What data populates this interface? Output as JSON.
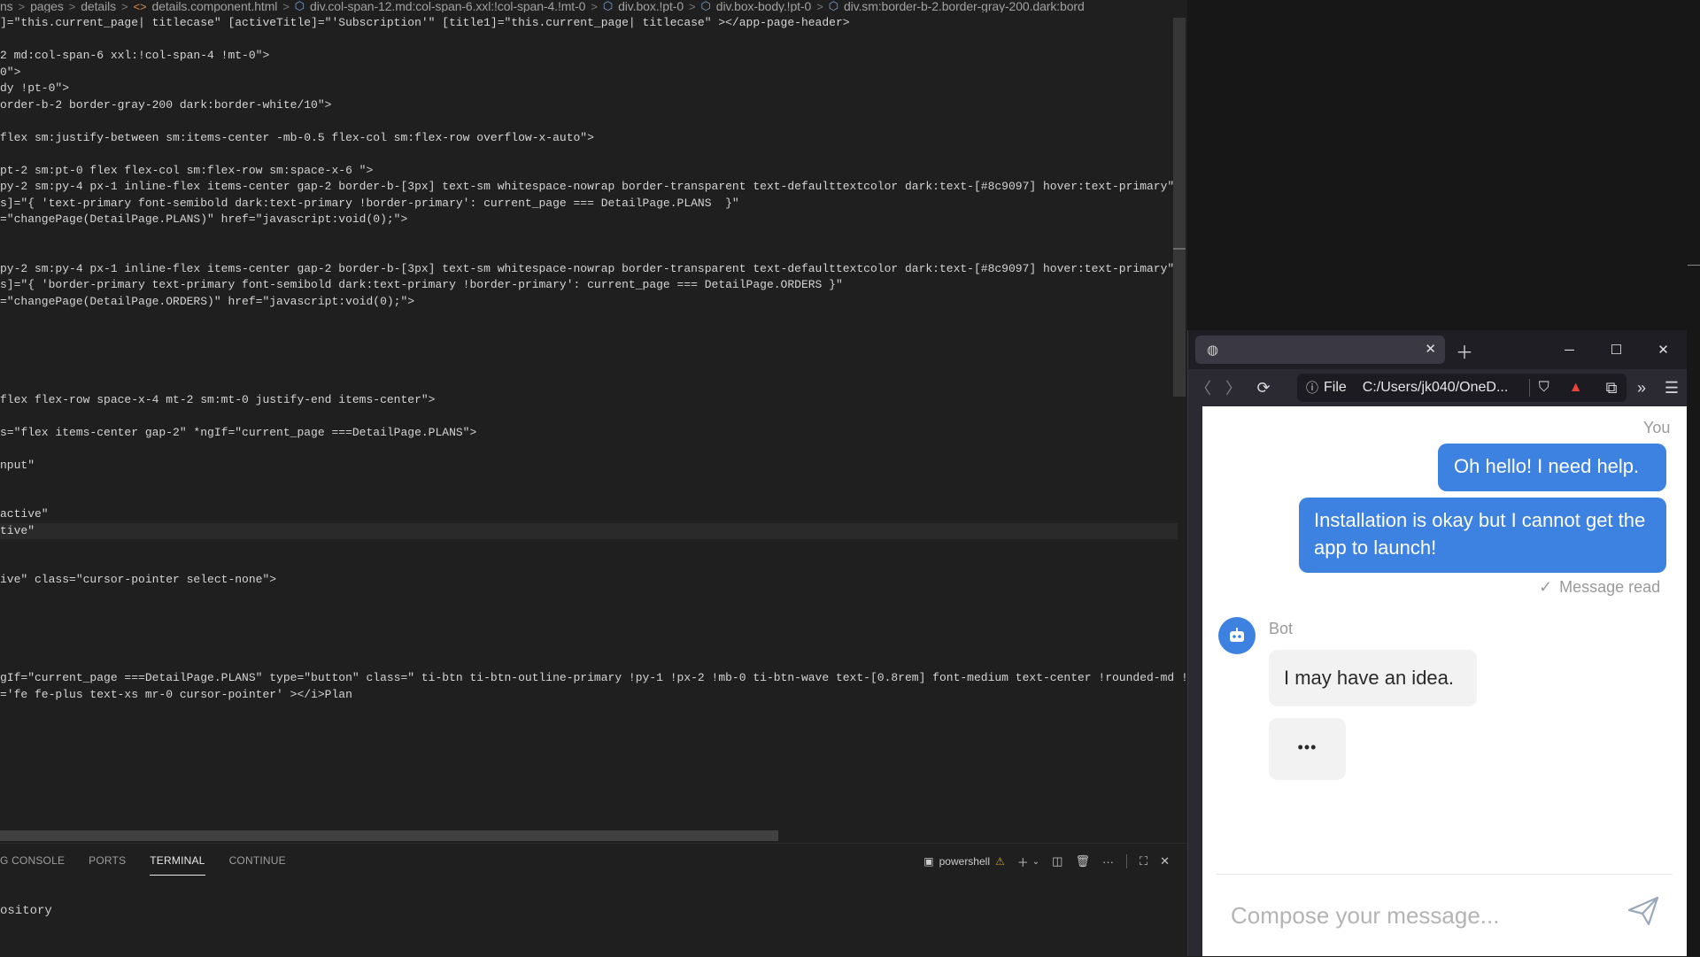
{
  "editor": {
    "breadcrumbs": [
      {
        "icon": "",
        "label": "ns"
      },
      {
        "icon": "",
        "label": "pages"
      },
      {
        "icon": "",
        "label": "details"
      },
      {
        "icon": "html-file-icon",
        "label": "details.component.html"
      },
      {
        "icon": "cube-icon",
        "label": "div.col-span-12.md:col-span-6.xxl:!col-span-4.!mt-0"
      },
      {
        "icon": "cube-icon",
        "label": "div.box.!pt-0"
      },
      {
        "icon": "cube-icon",
        "label": "div.box-body.!pt-0"
      },
      {
        "icon": "cube-icon",
        "label": "div.sm:border-b-2.border-gray-200.dark:bord"
      }
    ],
    "lines": [
      "]=\"this.current_page| titlecase\" [activeTitle]=\"'Subscription'\" [title1]=\"this.current_page| titlecase\" ></app-page-header>",
      "",
      "2 md:col-span-6 xxl:!col-span-4 !mt-0\">",
      "0\">",
      "dy !pt-0\">",
      "order-b-2 border-gray-200 dark:border-white/10\">",
      "",
      "flex sm:justify-between sm:items-center -mb-0.5 flex-col sm:flex-row overflow-x-auto\">",
      "",
      "pt-2 sm:pt-0 flex flex-col sm:flex-row sm:space-x-6 \">",
      "py-2 sm:py-4 px-1 inline-flex items-center gap-2 border-b-[3px] text-sm whitespace-nowrap border-transparent text-defaulttextcolor dark:text-[#8c9097] hover:text-primary\"",
      "s]=\"{ 'text-primary font-semibold dark:text-primary !border-primary': current_page === DetailPage.PLANS  }\"",
      "=\"changePage(DetailPage.PLANS)\" href=\"javascript:void(0);\">",
      "",
      "",
      "py-2 sm:py-4 px-1 inline-flex items-center gap-2 border-b-[3px] text-sm whitespace-nowrap border-transparent text-defaulttextcolor dark:text-[#8c9097] hover:text-primary\"",
      "s]=\"{ 'border-primary text-primary font-semibold dark:text-primary !border-primary': current_page === DetailPage.ORDERS }\"",
      "=\"changePage(DetailPage.ORDERS)\" href=\"javascript:void(0);\">",
      "",
      "",
      "",
      "",
      "",
      "flex flex-row space-x-4 mt-2 sm:mt-0 justify-end items-center\">",
      "",
      "s=\"flex items-center gap-2\" *ngIf=\"current_page ===DetailPage.PLANS\">",
      "",
      "nput\"",
      "",
      "",
      "active\"",
      "tive\"",
      "",
      "",
      "ive\" class=\"cursor-pointer select-none\">",
      "",
      "",
      "",
      "",
      "",
      "gIf=\"current_page ===DetailPage.PLANS\" type=\"button\" class=\" ti-btn ti-btn-outline-primary !py-1 !px-2 !mb-0 ti-btn-wave text-[0.8rem] font-medium text-center !rounded-md !lead",
      "='fe fe-plus text-xs mr-0 cursor-pointer' ></i>Plan"
    ],
    "active_line_index": 31
  },
  "panel": {
    "tabs": [
      {
        "label": "G CONSOLE",
        "active": false
      },
      {
        "label": "PORTS",
        "active": false
      },
      {
        "label": "TERMINAL",
        "active": true
      },
      {
        "label": "CONTINUE",
        "active": false
      }
    ],
    "terminal_name": "powershell",
    "terminal_output": "ository"
  },
  "browser": {
    "url_protocol": "File",
    "url": "C:/Users/jk040/OneD..."
  },
  "chat": {
    "user_label": "You",
    "bot_label": "Bot",
    "messages": [
      {
        "from": "user",
        "text": "Oh hello! I need help."
      },
      {
        "from": "user",
        "text": "Installation is okay but I cannot get the app to launch!"
      },
      {
        "from": "bot",
        "text": "I may have an idea."
      }
    ],
    "read_status": "Message read",
    "typing_indicator": "•••",
    "compose_placeholder": "Compose your message..."
  },
  "colors": {
    "user_bubble": "#3d82e0",
    "bot_bubble": "#f2f2f2",
    "editor_bg": "#1f1f1f"
  }
}
